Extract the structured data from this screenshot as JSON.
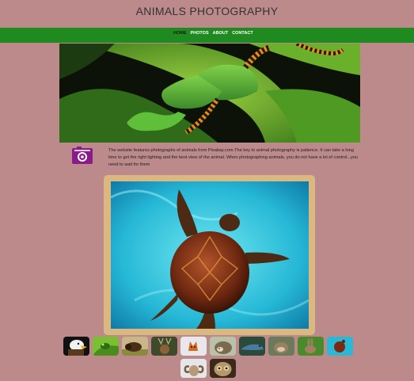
{
  "header": {
    "title": "ANIMALS PHOTOGRAPHY"
  },
  "nav": {
    "items": [
      {
        "label": "HOME",
        "active": true
      },
      {
        "label": "PHOTOS",
        "active": false
      },
      {
        "label": "ABOUT",
        "active": false
      },
      {
        "label": "CONTACT",
        "active": false
      }
    ]
  },
  "colors": {
    "background": "#bc8a8b",
    "nav": "#1f8a1f",
    "frame": "#dbb882",
    "icon": "#8b1a8b"
  },
  "intro": {
    "icon": "camera-icon",
    "text": "The website features photographs of animals from Pixabay.com.The key to animal photography is patience. It can take a long time to get the right lighting and the best view of the animal. When photographing animals, you do not have a lot of control...you need to wait for them"
  },
  "gallery": {
    "hero": "tree-frog-photo",
    "featured": "sea-turtle-photo",
    "thumbnails": [
      "eagle-thumb",
      "frog-thumb",
      "bison-thumb",
      "deer-thumb",
      "fox-thumb",
      "hedgehog-thumb",
      "lizard-thumb",
      "otter-thumb",
      "rabbit-thumb",
      "turtle-thumb",
      "ram-thumb",
      "owl-thumb"
    ]
  }
}
